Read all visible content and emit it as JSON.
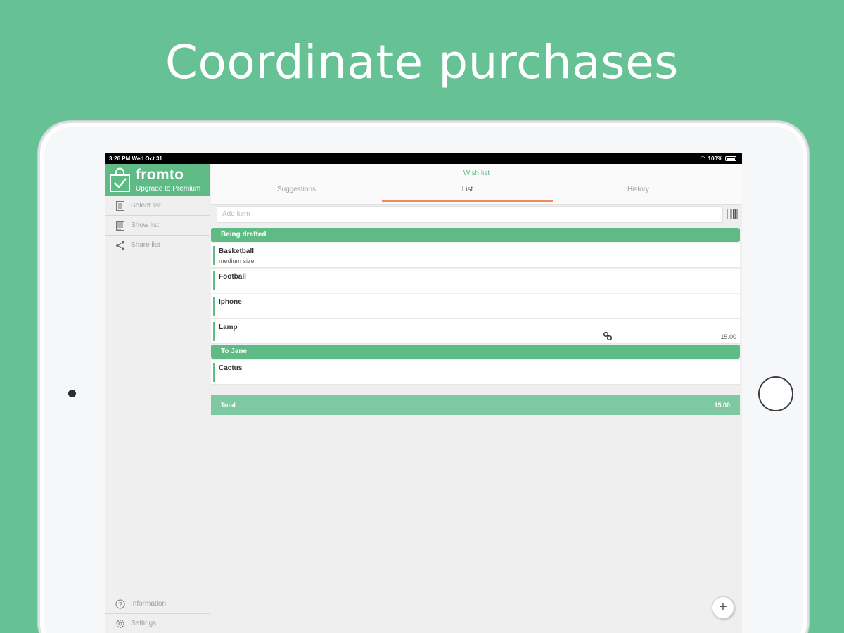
{
  "headline": "Coordinate purchases",
  "status": {
    "time": "3:26 PM   Wed Oct 31",
    "battery": "100%"
  },
  "sidebar": {
    "brand_name": "fromto",
    "upgrade_label": "Upgrade to Premium",
    "items": [
      {
        "label": "Select list",
        "icon": "list-icon"
      },
      {
        "label": "Show list",
        "icon": "document-icon"
      },
      {
        "label": "Share list",
        "icon": "share-icon"
      }
    ],
    "bottom": [
      {
        "label": "Information",
        "icon": "help-icon"
      },
      {
        "label": "Settings",
        "icon": "gear-icon"
      }
    ]
  },
  "main": {
    "title": "Wish list",
    "tabs": [
      {
        "label": "Suggestions"
      },
      {
        "label": "List"
      },
      {
        "label": "History"
      }
    ],
    "add_placeholder": "Add item",
    "sections": [
      {
        "title": "Being drafted",
        "items": [
          {
            "name": "Basketball",
            "desc": "medium size",
            "price": ""
          },
          {
            "name": "Football",
            "desc": "",
            "price": ""
          },
          {
            "name": "Iphone",
            "desc": "",
            "price": ""
          },
          {
            "name": "Lamp",
            "desc": "",
            "price": "15.00"
          }
        ]
      },
      {
        "title": "To Jane",
        "items": [
          {
            "name": "Cactus",
            "desc": "",
            "price": ""
          }
        ]
      }
    ],
    "total_label": "Total",
    "total_value": "15.00",
    "fab_label": "+"
  },
  "colors": {
    "background": "#66c194",
    "brand": "#5fbb86",
    "tab_underline": "#f08a5d"
  }
}
